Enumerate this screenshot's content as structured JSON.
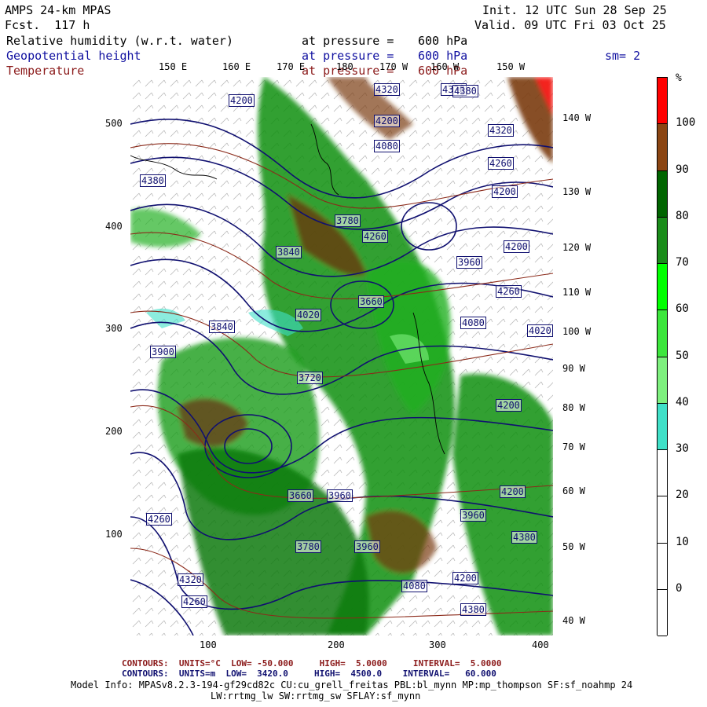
{
  "header": {
    "model": "AMPS 24-km MPAS",
    "fcst": "Fcst.  117 h",
    "init": "Init. 12 UTC Sun 28 Sep 25",
    "valid": "Valid. 09 UTC Fri 03 Oct 25",
    "field1": "Relative humidity (w.r.t. water)",
    "field2": "Geopotential height",
    "field3": "Temperature",
    "pressure_label": "at pressure =",
    "pressure_value": "600 hPa",
    "smoothing": "sm= 2"
  },
  "colors": {
    "field1": "#000000",
    "field2": "#1010a0",
    "field3": "#8b1a1a",
    "height_contour": "#101070",
    "temp_contour": "#8b2a1a"
  },
  "top_lon_labels": [
    "150 E",
    "160 E",
    "170 E",
    "180",
    "170 W",
    "160 W",
    "150 W"
  ],
  "right_lon_labels": [
    "140 W",
    "130 W",
    "120 W",
    "110 W",
    "100 W",
    "90 W",
    "80 W",
    "70 W",
    "60 W",
    "50 W",
    "40 W"
  ],
  "x_ticks": [
    "100",
    "200",
    "300",
    "400"
  ],
  "y_ticks": [
    "500",
    "400",
    "300",
    "200",
    "100"
  ],
  "height_labels": [
    "4320",
    "4320",
    "4200",
    "4200",
    "4080",
    "4320",
    "4260",
    "4380",
    "4200",
    "3960",
    "4200",
    "4260",
    "4020",
    "4080",
    "3840",
    "3780",
    "3660",
    "3720",
    "3660",
    "3960",
    "4020",
    "3900",
    "3840",
    "3960",
    "4200",
    "4260",
    "4380",
    "3780",
    "3960",
    "4080",
    "4200",
    "4380",
    "4260",
    "4320",
    "4380",
    "4200",
    "4260"
  ],
  "colorbar": {
    "unit": "%",
    "colors": [
      "#ff0000",
      "#8b4513",
      "#006400",
      "#1a8c1a",
      "#00ff00",
      "#3ce63c",
      "#7ef07e",
      "#40e0c8",
      "#ffffff",
      "#ffffff",
      "#ffffff",
      "#ffffff"
    ],
    "labels": [
      "100",
      "90",
      "80",
      "70",
      "60",
      "50",
      "40",
      "30",
      "20",
      "10",
      "0"
    ]
  },
  "footer": {
    "line1": "CONTOURS:  UNITS=°C  LOW= -50.000     HIGH=  5.0000     INTERVAL=  5.0000",
    "line2": "CONTOURS:  UNITS=m  LOW=  3420.0     HIGH=  4500.0    INTERVAL=   60.000",
    "line3": "Model Info: MPASv8.2.3-194-gf29cd82c CU:cu_grell_freitas PBL:bl_mynn MP:mp_thompson SF:sf_noahmp 24",
    "line4": "LW:rrtmg_lw SW:rrtmg_sw SFLAY:sf_mynn"
  }
}
